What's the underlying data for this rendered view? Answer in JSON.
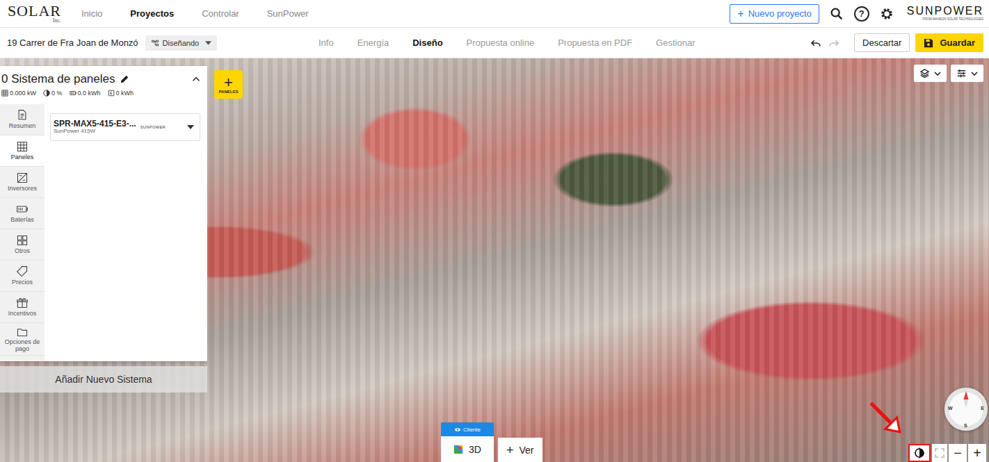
{
  "top_nav": {
    "logo": "SOLAR",
    "logo_suffix": "Inc.",
    "items": [
      {
        "label": "Inicio",
        "selected": false
      },
      {
        "label": "Proyectos",
        "selected": true
      },
      {
        "label": "Controlar",
        "selected": false
      },
      {
        "label": "SunPower",
        "selected": false
      }
    ],
    "new_project_icon": "+",
    "new_project": "Nuevo proyecto",
    "help": "?",
    "brand": "SUNPOWER",
    "brand_sub": "FROM MAXEON SOLAR TECHNOLOGIES"
  },
  "project_bar": {
    "address": "19 Carrer de Fra Joan de Monzó",
    "status": "Diseñando",
    "tabs": [
      {
        "label": "Info",
        "selected": false
      },
      {
        "label": "Energía",
        "selected": false
      },
      {
        "label": "Diseño",
        "selected": true
      },
      {
        "label": "Propuesta online",
        "selected": false
      },
      {
        "label": "Propuesta en PDF",
        "selected": false
      },
      {
        "label": "Gestionar",
        "selected": false
      }
    ],
    "discard": "Descartar",
    "save": "Guardar"
  },
  "system_panel": {
    "title": "0 Sistema de paneles",
    "stats": [
      "0.000 kW",
      "0 %",
      "0.0 kWh",
      "0 kWh"
    ],
    "side_tabs": [
      {
        "label": "Resumen",
        "selected": false
      },
      {
        "label": "Paneles",
        "selected": true
      },
      {
        "label": "Inversores",
        "selected": false
      },
      {
        "label": "Baterías",
        "selected": false
      },
      {
        "label": "Otros",
        "selected": false
      },
      {
        "label": "Precios",
        "selected": false
      },
      {
        "label": "Incentivos",
        "selected": false
      },
      {
        "label": "Opciones de pago",
        "selected": false
      }
    ],
    "module": {
      "name": "SPR-MAX5-415-E3-...",
      "sub": "SunPower 415W",
      "brand": "SUNPOWER"
    },
    "add_system": "Añadir Nuevo Sistema"
  },
  "add_panels": {
    "icon": "+",
    "label": "PANELES"
  },
  "view_controls": {
    "client_badge": "Cliente",
    "mode": "3D",
    "add_icon": "+",
    "add_view": "Ver"
  },
  "compass": {
    "letters": [
      "W",
      "E",
      "S"
    ]
  },
  "map_tools": {
    "shading_highlighted": true,
    "zoom_out": "−",
    "zoom_in": "+"
  }
}
